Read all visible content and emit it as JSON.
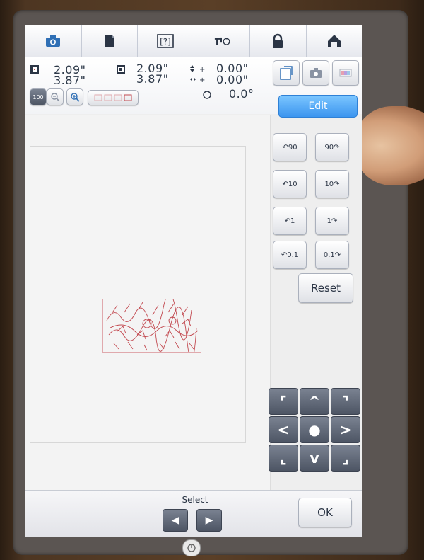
{
  "tabs": [
    {
      "id": "camera",
      "icon": "camera-icon"
    },
    {
      "id": "document",
      "icon": "document-icon"
    },
    {
      "id": "help",
      "icon": "help-icon",
      "label": "[?]"
    },
    {
      "id": "settings",
      "icon": "machine-settings-icon"
    },
    {
      "id": "lock",
      "icon": "lock-icon"
    },
    {
      "id": "home",
      "icon": "home-icon"
    }
  ],
  "size": {
    "width": "2.09\"",
    "height": "3.87\""
  },
  "size2": {
    "width": "2.09\"",
    "height": "3.87\""
  },
  "position": {
    "vertical": "0.00\"",
    "horizontal": "0.00\""
  },
  "rotation": {
    "angle": "0.0°"
  },
  "zoom": {
    "level_label": "100"
  },
  "edit_label": "Edit",
  "rotate_buttons": [
    {
      "left": "90",
      "right": "90"
    },
    {
      "left": "10",
      "right": "10"
    },
    {
      "left": "1",
      "right": "1"
    },
    {
      "left": "0.1",
      "right": "0.1"
    }
  ],
  "reset_label": "Reset",
  "select_label": "Select",
  "ok_label": "OK",
  "colors": {
    "accent": "#3c95ef",
    "pattern": "#c2484f"
  }
}
